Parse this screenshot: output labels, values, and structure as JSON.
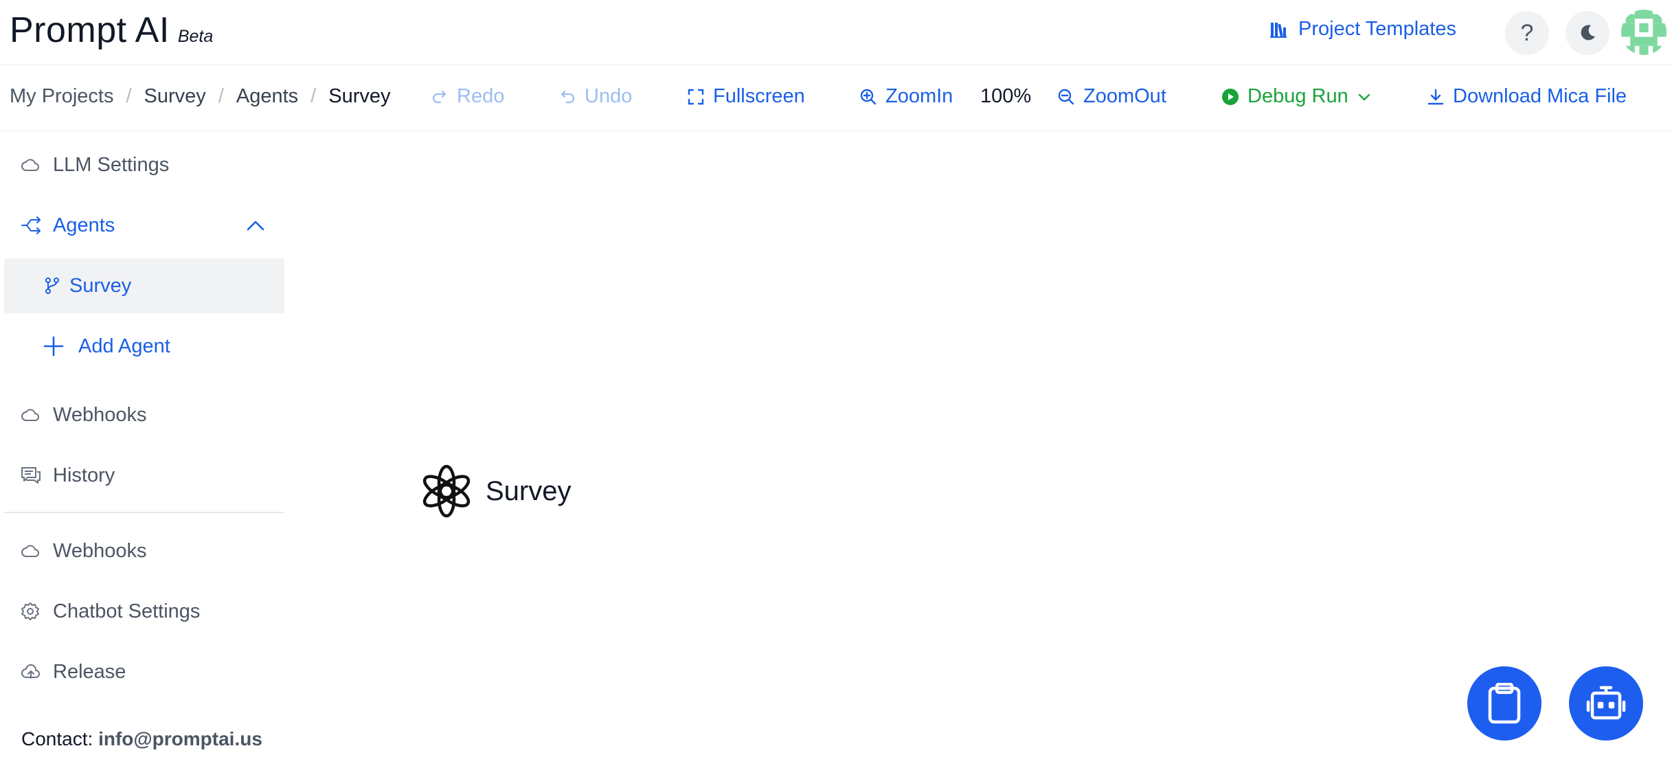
{
  "header": {
    "title": "Prompt AI",
    "badge": "Beta",
    "templates_link": "Project Templates",
    "help_label": "?"
  },
  "breadcrumb": [
    "My Projects",
    "Survey",
    "Agents",
    "Survey"
  ],
  "breadcrumb_separator": "/",
  "toolbar": {
    "redo": "Redo",
    "undo": "Undo",
    "fullscreen": "Fullscreen",
    "zoom_in": "ZoomIn",
    "zoom_level": "100%",
    "zoom_out": "ZoomOut",
    "debug_run": "Debug Run",
    "download": "Download Mica File"
  },
  "sidebar": {
    "llm_settings": "LLM Settings",
    "agents": "Agents",
    "agent_items": [
      "Survey"
    ],
    "add_agent": "Add Agent",
    "webhooks": "Webhooks",
    "history": "History",
    "webhooks_2": "Webhooks",
    "chatbot_settings": "Chatbot Settings",
    "release": "Release"
  },
  "contact": {
    "label": "Contact:",
    "email": "info@promptai.us"
  },
  "canvas": {
    "node_label": "Survey",
    "node_icon": "openai-logo-icon"
  },
  "fabs": [
    "clipboard-icon",
    "robot-icon"
  ],
  "colors": {
    "accent": "#1a5fe6",
    "accent_disabled": "#9cbdf3",
    "debug_green": "#1aa33b",
    "fab_blue": "#1e5eef",
    "active_bg": "#f1f2f4",
    "avatar_green": "#7ed9a0"
  }
}
